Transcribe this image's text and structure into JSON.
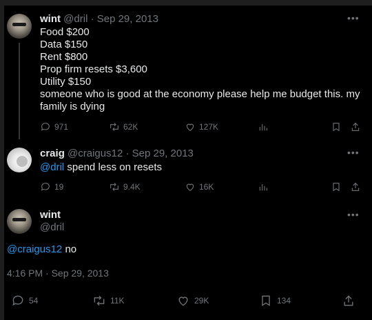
{
  "tweet1": {
    "name": "wint",
    "meta": "@dril · Sep 29, 2013",
    "lines": [
      "Food $200",
      "Data $150",
      "Rent $800",
      "Prop firm resets $3,600",
      "Utility $150",
      "someone who is good at the economy please help me budget this. my",
      "family is dying"
    ],
    "stats": {
      "replies": "971",
      "reposts": "62K",
      "likes": "127K"
    }
  },
  "tweet2": {
    "name": "craig",
    "meta": "@craigus12 · Sep 29, 2013",
    "mention": "@dril",
    "text": " spend less on resets",
    "stats": {
      "replies": "19",
      "reposts": "9.4K",
      "likes": "16K"
    }
  },
  "tweet3": {
    "name": "wint",
    "handle": "@dril",
    "mention": "@craigus12",
    "text": " no",
    "timestamp": "4:16 PM · Sep 29, 2013",
    "stats": {
      "replies": "54",
      "reposts": "11K",
      "likes": "29K",
      "bookmarks": "134"
    }
  },
  "colors": {
    "accent": "#1d9bf0",
    "muted": "#71767b",
    "text": "#e7e9ea",
    "background": "#000000"
  },
  "icons": [
    "reply-icon",
    "repost-icon",
    "like-icon",
    "views-icon",
    "bookmark-icon",
    "share-icon",
    "more-icon"
  ]
}
